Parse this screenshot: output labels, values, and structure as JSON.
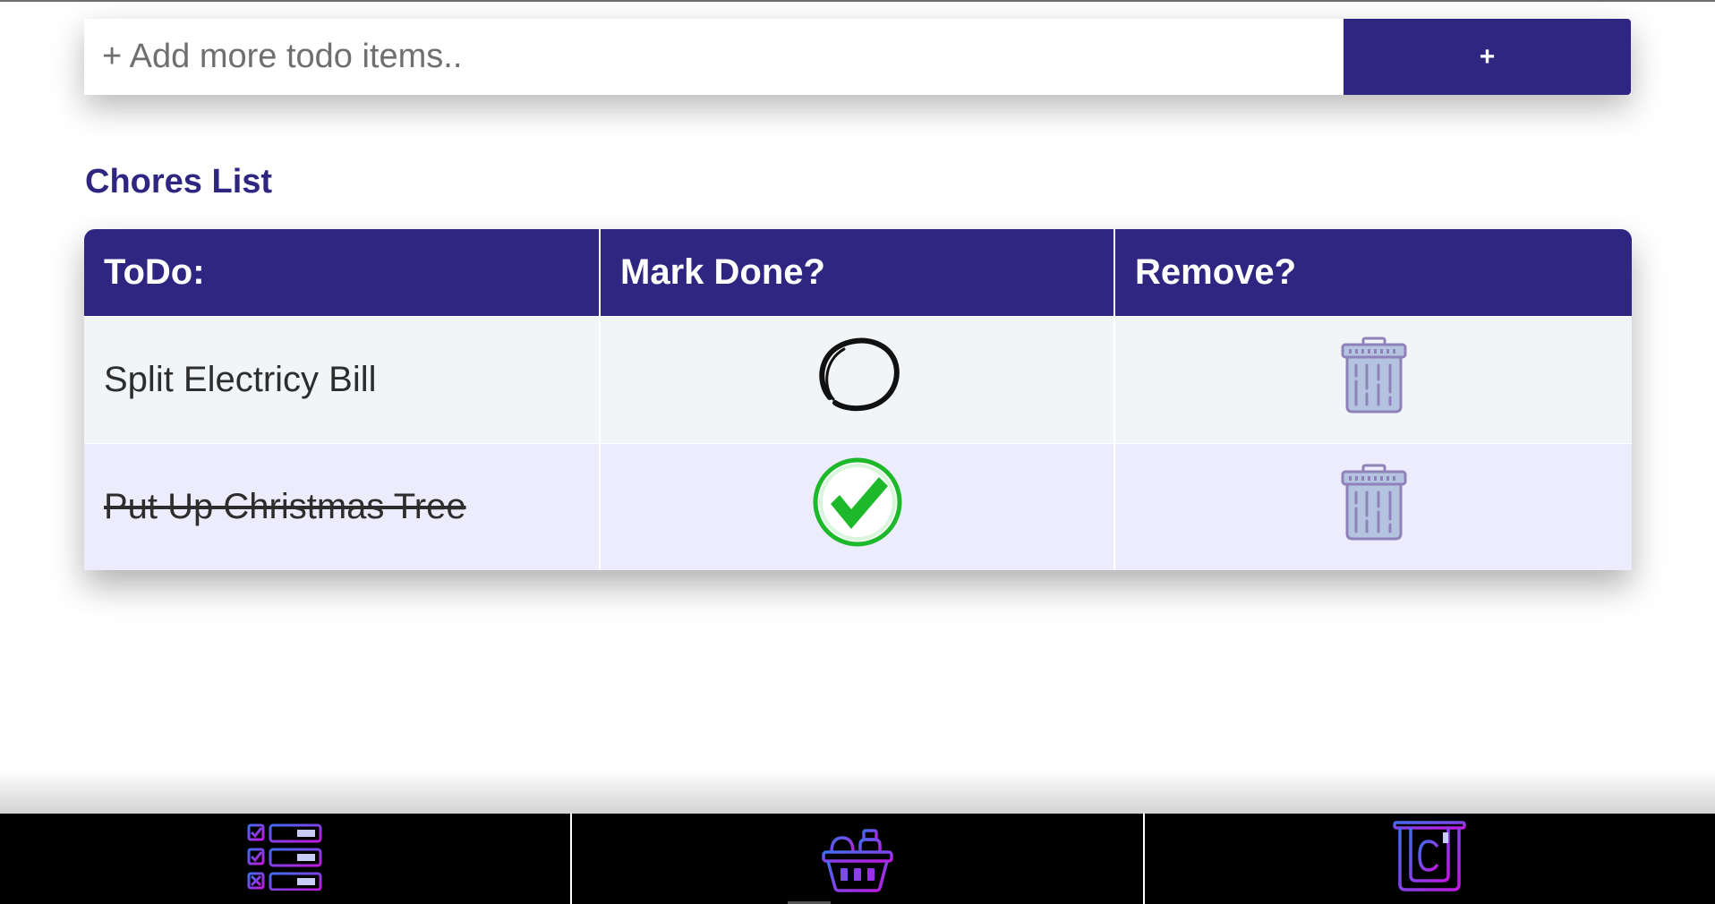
{
  "add_bar": {
    "placeholder": "+ Add more todo items..",
    "button_label": "+"
  },
  "list": {
    "title": "Chores List",
    "columns": [
      "ToDo:",
      "Mark Done?",
      "Remove?"
    ],
    "items": [
      {
        "text": "Split Electricy Bill",
        "done": false
      },
      {
        "text": "Put Up Christmas Tree",
        "done": true
      }
    ]
  },
  "footer_nav": {
    "items": [
      {
        "icon": "checklist-icon"
      },
      {
        "icon": "shopping-basket-icon"
      },
      {
        "icon": "euro-bill-icon"
      }
    ]
  },
  "colors": {
    "primary": "#2f2682",
    "row_a": "#f2f5f7",
    "row_b": "#edecfc",
    "check_green": "#1db92b",
    "trash": "#8f82b8",
    "nav_bg": "#000000"
  }
}
